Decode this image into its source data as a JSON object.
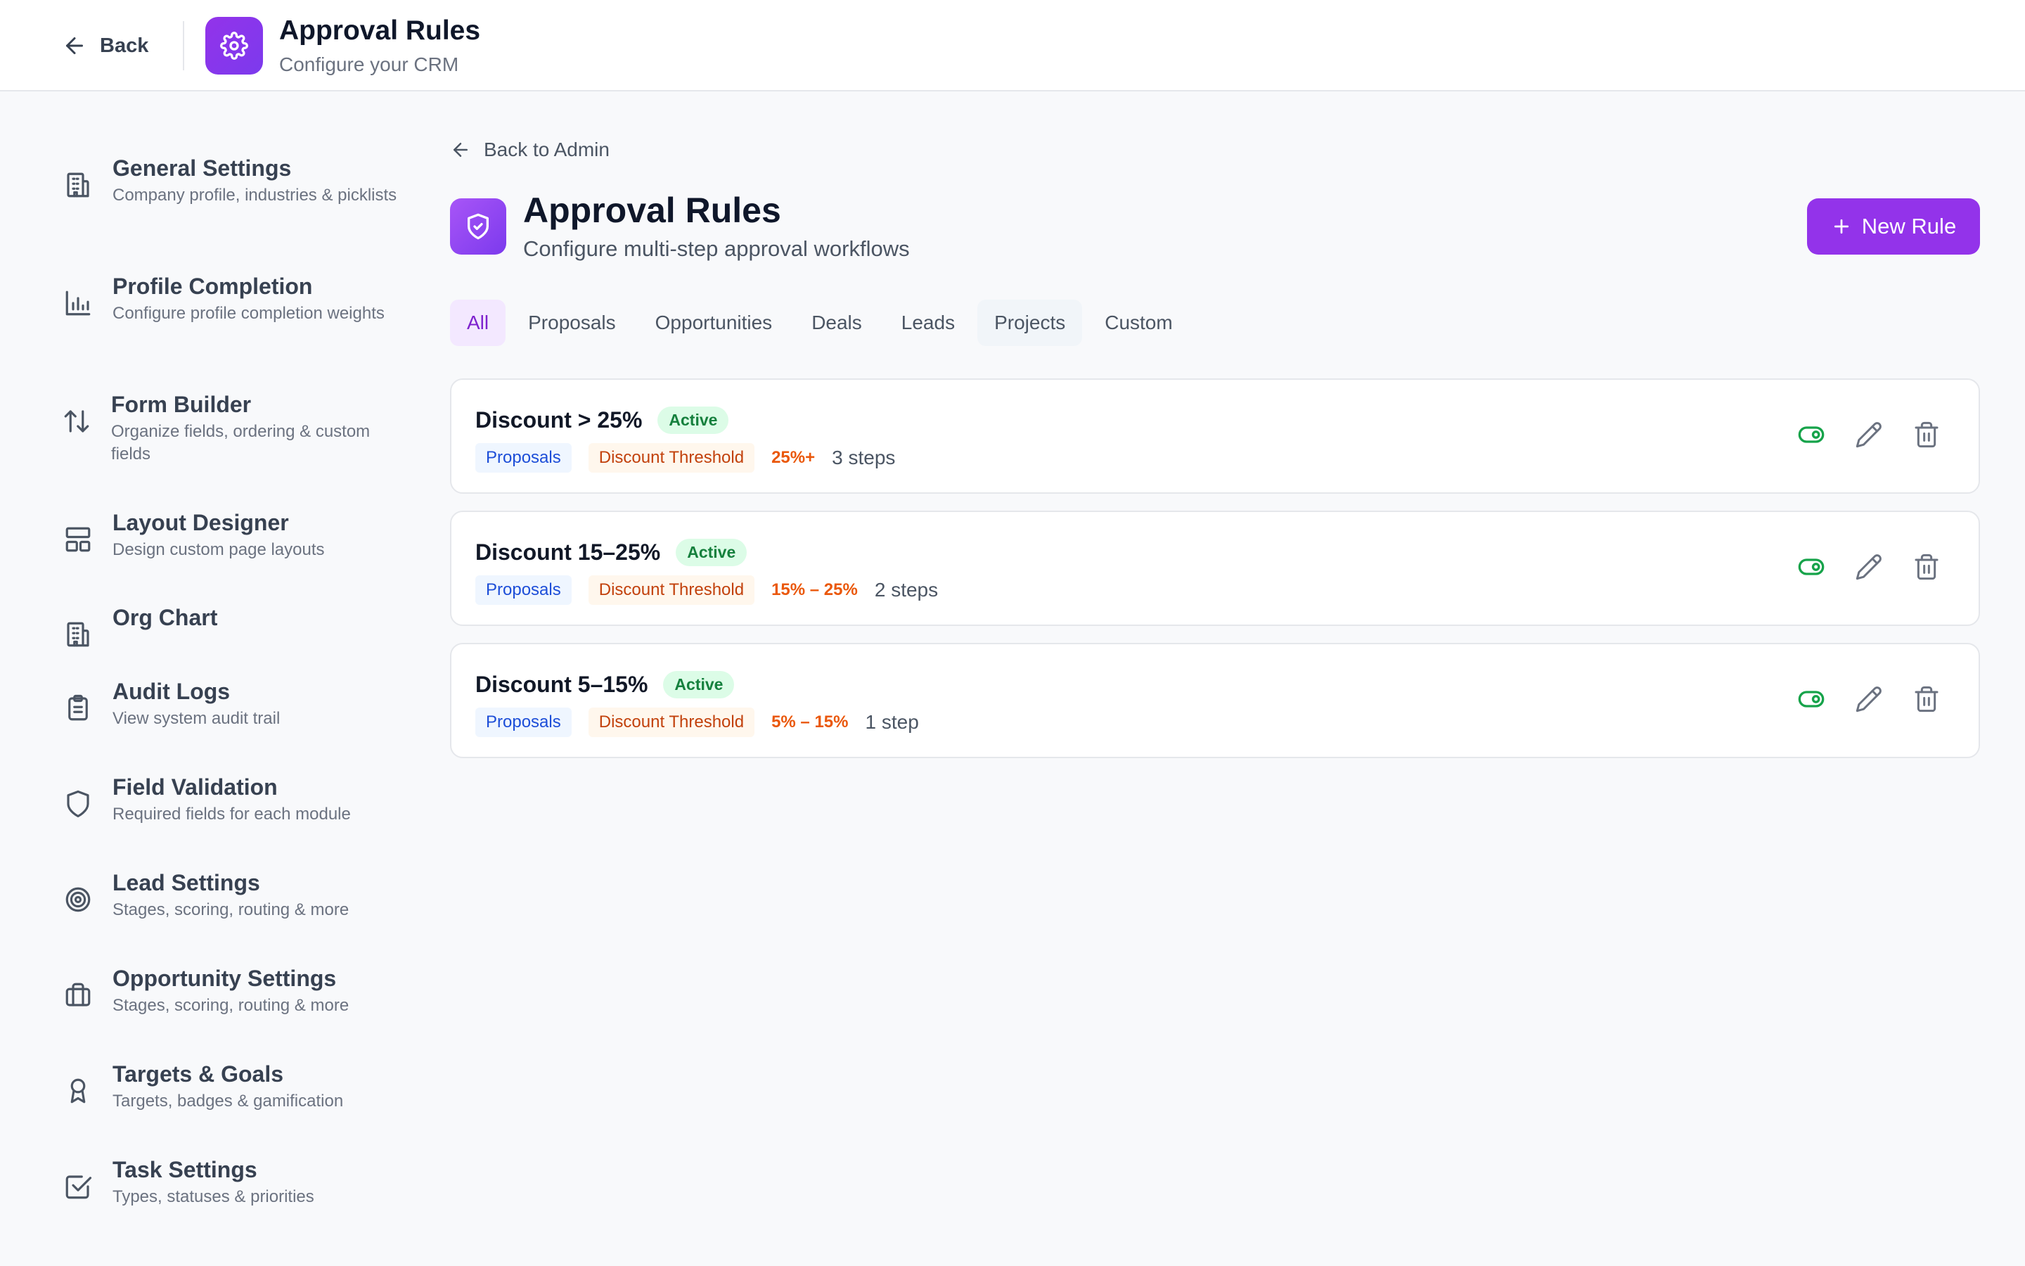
{
  "header": {
    "back_label": "Back",
    "title": "Approval Rules",
    "subtitle": "Configure your CRM",
    "app_icon": "gear-icon"
  },
  "sidebar": {
    "items": [
      {
        "label": "General Settings",
        "desc": "Company profile, industries & picklists",
        "icon": "building-icon"
      },
      {
        "label": "Profile Completion",
        "desc": "Configure profile completion weights",
        "icon": "bar-chart-icon"
      },
      {
        "label": "Form Builder",
        "desc": "Organize fields, ordering & custom fields",
        "icon": "sort-arrows-icon"
      },
      {
        "label": "Layout Designer",
        "desc": "Design custom page layouts",
        "icon": "layout-icon"
      },
      {
        "label": "Org Chart",
        "desc": "",
        "icon": "building-icon"
      },
      {
        "label": "Audit Logs",
        "desc": "View system audit trail",
        "icon": "clipboard-icon"
      },
      {
        "label": "Field Validation",
        "desc": "Required fields for each module",
        "icon": "shield-icon"
      },
      {
        "label": "Lead Settings",
        "desc": "Stages, scoring, routing & more",
        "icon": "target-icon"
      },
      {
        "label": "Opportunity Settings",
        "desc": "Stages, scoring, routing & more",
        "icon": "briefcase-icon"
      },
      {
        "label": "Targets & Goals",
        "desc": "Targets, badges & gamification",
        "icon": "award-icon"
      },
      {
        "label": "Task Settings",
        "desc": "Types, statuses & priorities",
        "icon": "checkbox-icon"
      }
    ]
  },
  "main": {
    "back_label": "Back to Admin",
    "title": "Approval Rules",
    "subtitle": "Configure multi-step approval workflows",
    "new_rule_label": "New Rule",
    "page_icon": "shield-check-icon",
    "tabs": [
      "All",
      "Proposals",
      "Opportunities",
      "Deals",
      "Leads",
      "Projects",
      "Custom"
    ],
    "active_tab": "All",
    "rules": [
      {
        "name": "Discount > 25%",
        "status": "Active",
        "module": "Proposals",
        "type": "Discount Threshold",
        "range": "25%+",
        "steps": "3 steps"
      },
      {
        "name": "Discount 15–25%",
        "status": "Active",
        "module": "Proposals",
        "type": "Discount Threshold",
        "range": "15% – 25%",
        "steps": "2 steps"
      },
      {
        "name": "Discount 5–15%",
        "status": "Active",
        "module": "Proposals",
        "type": "Discount Threshold",
        "range": "5% – 15%",
        "steps": "1 step"
      }
    ]
  },
  "colors": {
    "accent": "#9333ea",
    "active_badge_bg": "#dcfce7",
    "active_badge_text": "#15803d",
    "toggle_on": "#16a34a"
  }
}
